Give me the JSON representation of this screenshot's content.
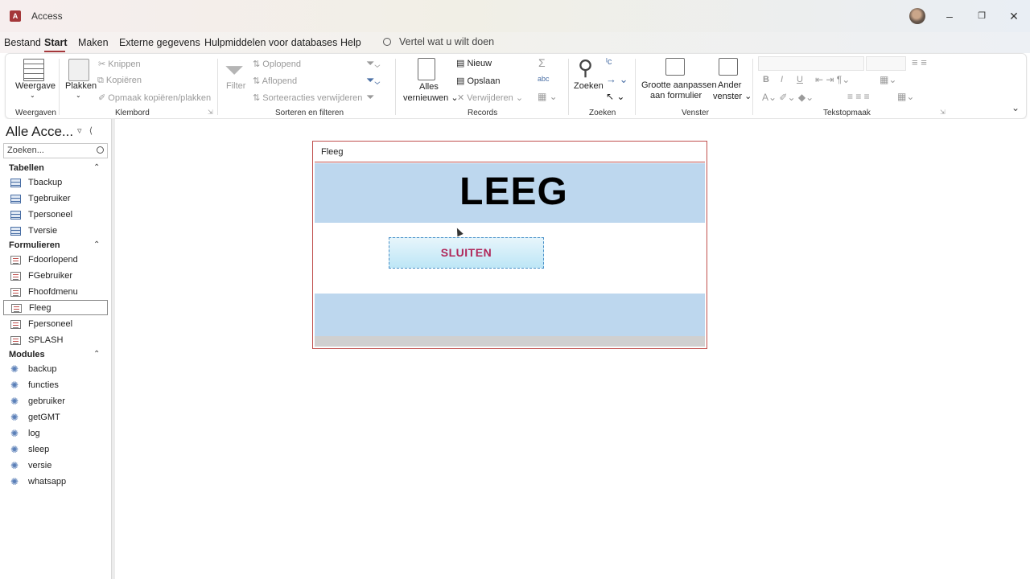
{
  "app": {
    "title": "Access"
  },
  "menu": {
    "items": [
      "Bestand",
      "Start",
      "Maken",
      "Externe gegevens",
      "Hulpmiddelen voor databases",
      "Help"
    ],
    "tell_me": "Vertel wat u wilt doen"
  },
  "ribbon": {
    "weergaven": {
      "btn": "Weergave",
      "label": "Weergaven"
    },
    "klembord": {
      "plakken": "Plakken",
      "knippen": "Knippen",
      "kopieren": "Kopiëren",
      "opmaak": "Opmaak kopiëren/plakken",
      "label": "Klembord"
    },
    "sorteren": {
      "filter": "Filter",
      "oplopend": "Oplopend",
      "aflopend": "Aflopend",
      "verwijderen": "Sorteeracties verwijderen",
      "label": "Sorteren en filteren"
    },
    "records": {
      "alles1": "Alles",
      "alles2": "vernieuwen",
      "nieuw": "Nieuw",
      "opslaan": "Opslaan",
      "verwijderen": "Verwijderen",
      "label": "Records"
    },
    "zoeken": {
      "btn": "Zoeken",
      "label": "Zoeken"
    },
    "venster": {
      "grootte1": "Grootte aanpassen",
      "grootte2": "aan formulier",
      "ander1": "Ander",
      "ander2": "venster",
      "label": "Venster"
    },
    "tekstopmaak": {
      "bold": "B",
      "italic": "I",
      "underline": "U",
      "label": "Tekstopmaak"
    }
  },
  "nav": {
    "title": "Alle Acce...",
    "search_placeholder": "Zoeken...",
    "groups": {
      "tabellen": {
        "label": "Tabellen",
        "items": [
          "Tbackup",
          "Tgebruiker",
          "Tpersoneel",
          "Tversie"
        ]
      },
      "formulieren": {
        "label": "Formulieren",
        "items": [
          "Fdoorlopend",
          "FGebruiker",
          "Fhoofdmenu",
          "Fleeg",
          "Fpersoneel",
          "SPLASH"
        ]
      },
      "modules": {
        "label": "Modules",
        "items": [
          "backup",
          "functies",
          "gebruiker",
          "getGMT",
          "log",
          "sleep",
          "versie",
          "whatsapp"
        ]
      }
    },
    "selected": "Fleeg"
  },
  "form": {
    "caption": "Fleeg",
    "heading": "LEEG",
    "button": "SLUITEN",
    "colors": {
      "section": "#bdd7ee",
      "border": "#c0504d",
      "button_text": "#b0275a"
    }
  }
}
